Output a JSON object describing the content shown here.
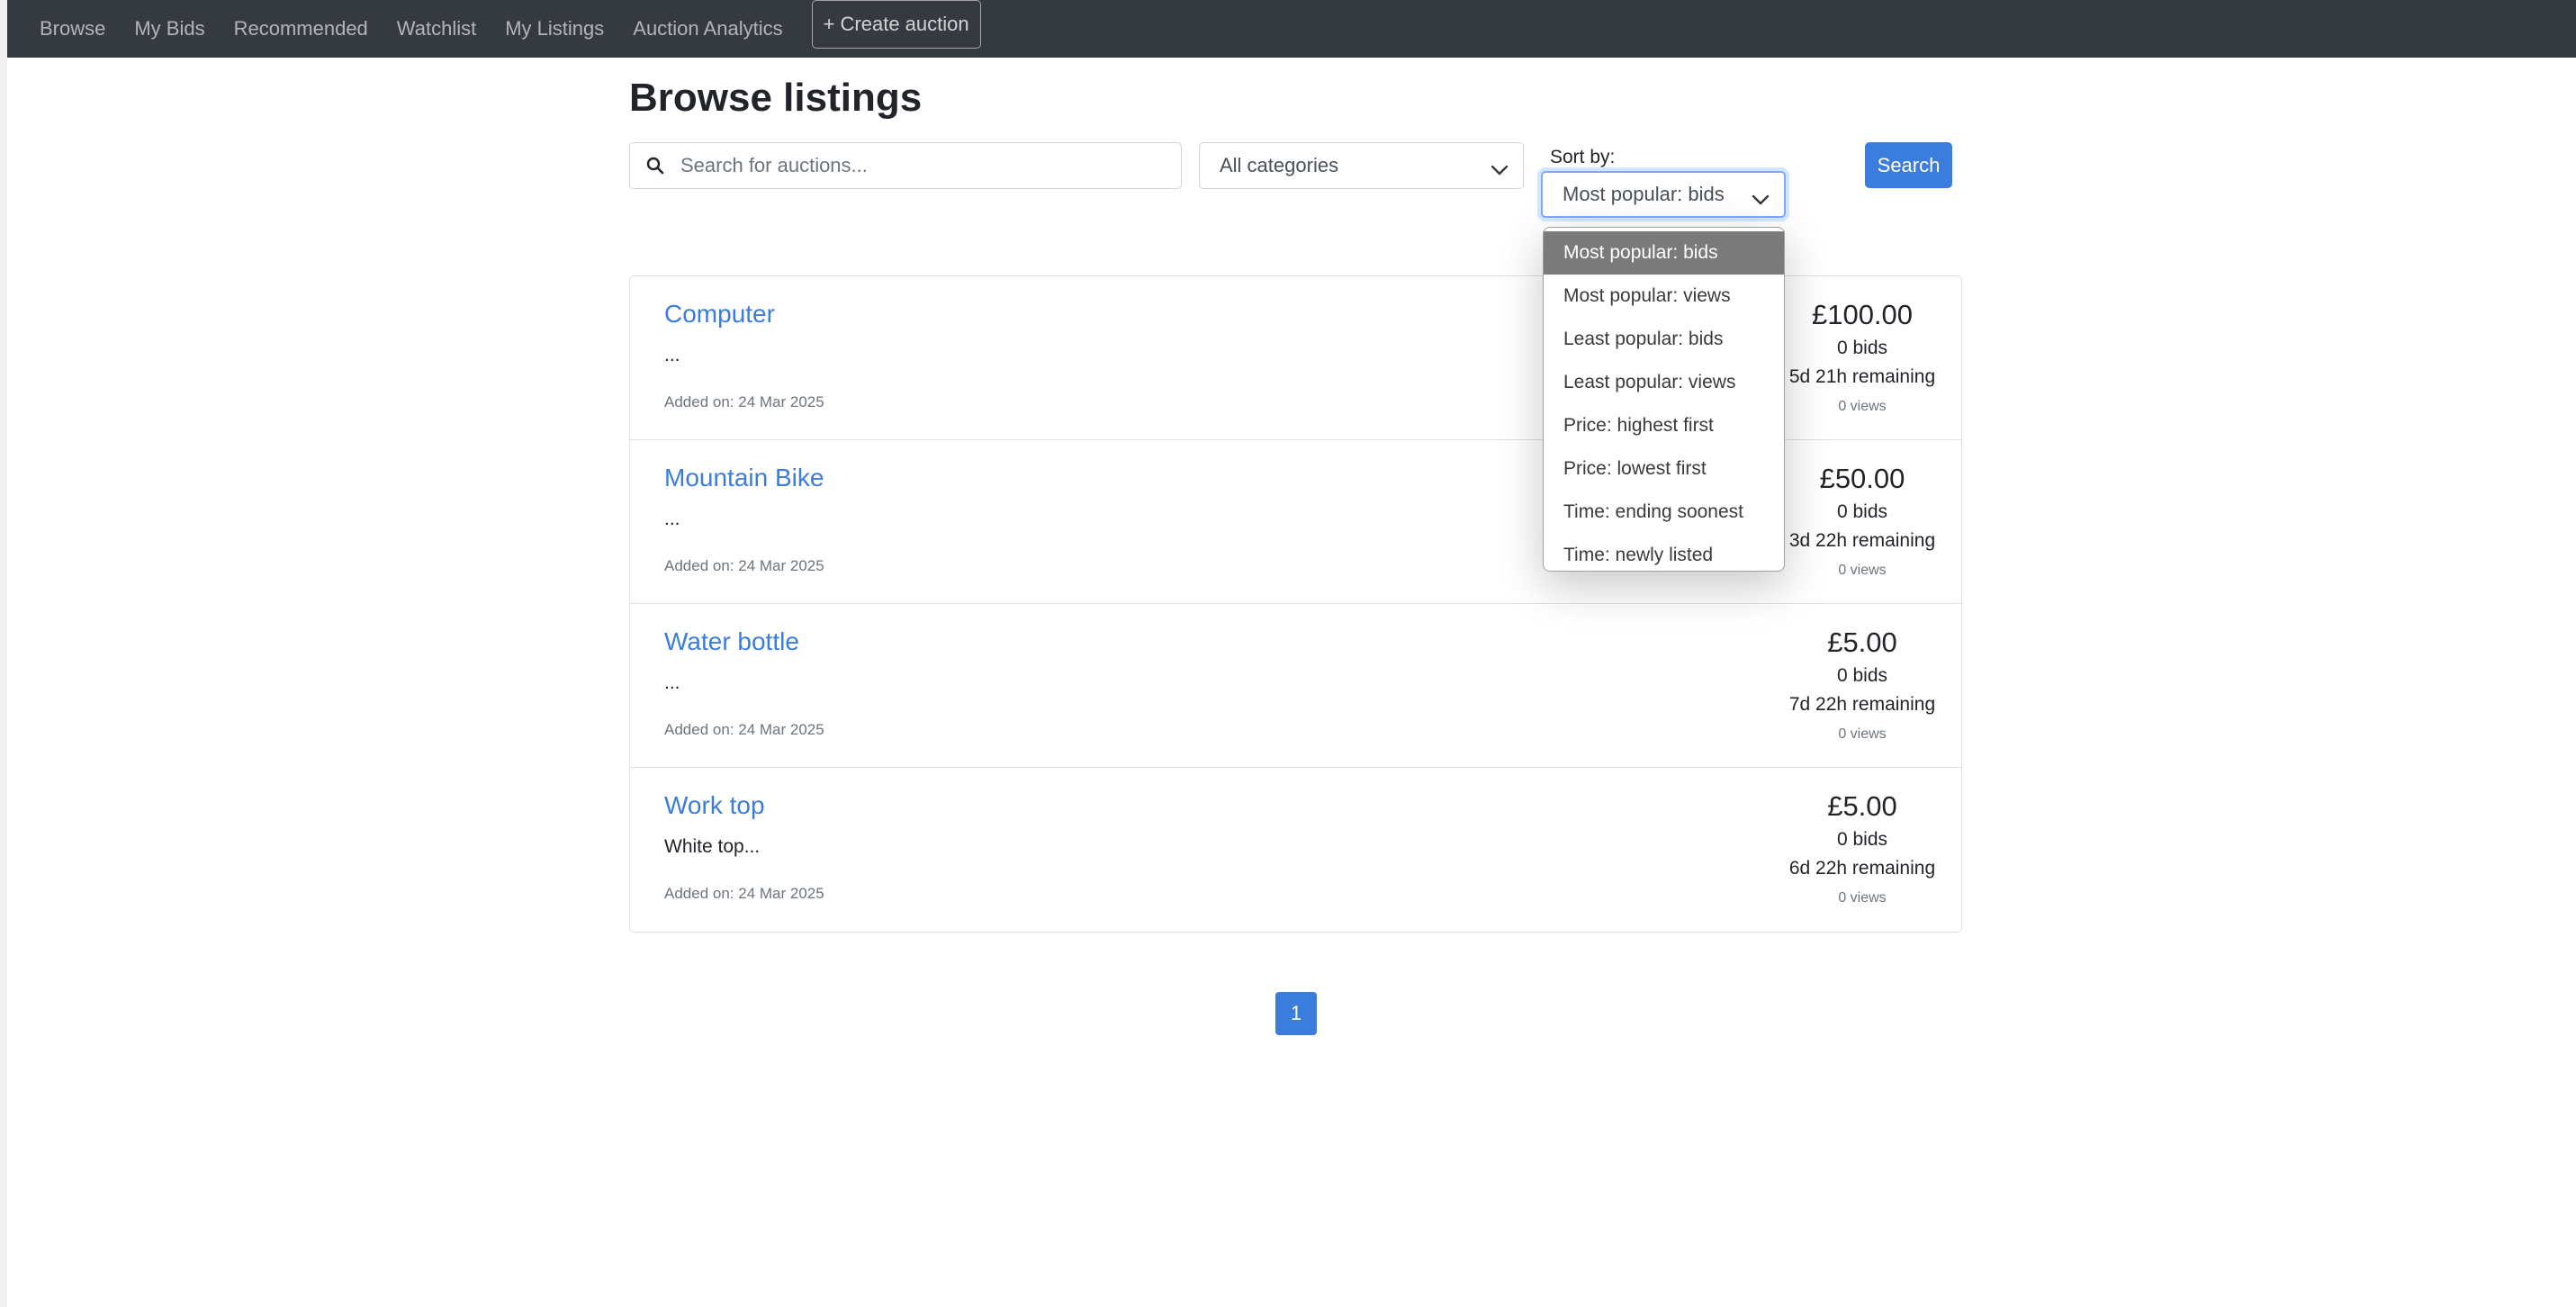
{
  "nav": {
    "items": [
      "Browse",
      "My Bids",
      "Recommended",
      "Watchlist",
      "My Listings",
      "Auction Analytics"
    ],
    "create_label": "+ Create auction"
  },
  "page": {
    "title": "Browse listings"
  },
  "search": {
    "placeholder": "Search for auctions...",
    "button_label": "Search"
  },
  "filters": {
    "category_value": "All categories",
    "sort_label": "Sort by:",
    "sort_value": "Most popular: bids",
    "sort_options": [
      "Most popular: bids",
      "Most popular: views",
      "Least popular: bids",
      "Least popular: views",
      "Price: highest first",
      "Price: lowest first",
      "Time: ending soonest",
      "Time: newly listed"
    ]
  },
  "listings": [
    {
      "title": "Computer",
      "description": "...",
      "added": "Added on: 24 Mar 2025",
      "price": "£100.00",
      "bids": "0 bids",
      "remaining": "5d 21h remaining",
      "views": "0 views"
    },
    {
      "title": "Mountain Bike",
      "description": "...",
      "added": "Added on: 24 Mar 2025",
      "price": "£50.00",
      "bids": "0 bids",
      "remaining": "3d 22h remaining",
      "views": "0 views"
    },
    {
      "title": "Water bottle",
      "description": "...",
      "added": "Added on: 24 Mar 2025",
      "price": "£5.00",
      "bids": "0 bids",
      "remaining": "7d 22h remaining",
      "views": "0 views"
    },
    {
      "title": "Work top",
      "description": "White top...",
      "added": "Added on: 24 Mar 2025",
      "price": "£5.00",
      "bids": "0 bids",
      "remaining": "6d 22h remaining",
      "views": "0 views"
    }
  ],
  "pagination": {
    "current": "1"
  },
  "colors": {
    "navbar": "#343a40",
    "primary": "#3b7ddd",
    "selected_option": "#7a7a7a"
  }
}
